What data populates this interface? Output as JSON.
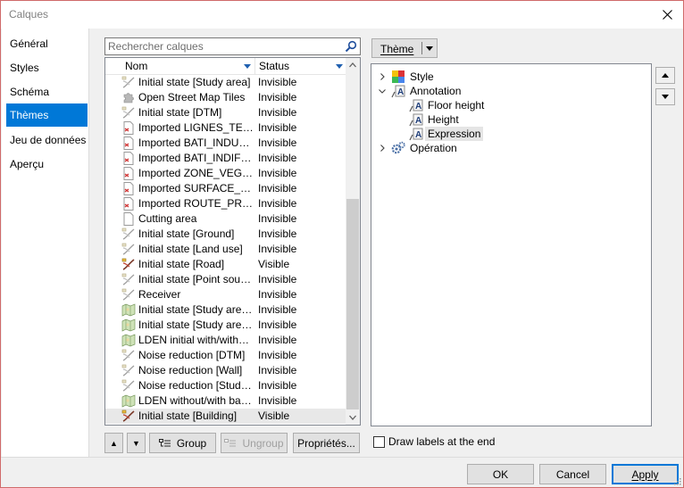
{
  "window": {
    "title": "Calques"
  },
  "nav": {
    "items": [
      {
        "label": "Général"
      },
      {
        "label": "Styles"
      },
      {
        "label": "Schéma"
      },
      {
        "label": "Thèmes"
      },
      {
        "label": "Jeu de données"
      },
      {
        "label": "Aperçu"
      }
    ],
    "active_index": 3
  },
  "search": {
    "placeholder": "Rechercher calques",
    "icon": "search-icon"
  },
  "layer_list": {
    "columns": {
      "name": "Nom",
      "status": "Status"
    },
    "rows": [
      {
        "name": "Initial state [Study area]",
        "status": "Invisible",
        "icon": "vector-style-icon"
      },
      {
        "name": "Open Street Map Tiles",
        "status": "Invisible",
        "icon": "puzzle-icon"
      },
      {
        "name": "Initial state [DTM]",
        "status": "Invisible",
        "icon": "vector-style-icon"
      },
      {
        "name": "Imported LIGNES_TERRITORY",
        "status": "Invisible",
        "icon": "document-layer-icon"
      },
      {
        "name": "Imported BATI_INDUSTRIEL",
        "status": "Invisible",
        "icon": "document-layer-icon"
      },
      {
        "name": "Imported BATI_INDIFFERENCIE",
        "status": "Invisible",
        "icon": "document-layer-icon"
      },
      {
        "name": "Imported ZONE_VEGETATION",
        "status": "Invisible",
        "icon": "document-layer-icon"
      },
      {
        "name": "Imported SURFACE_EAU",
        "status": "Invisible",
        "icon": "document-layer-icon"
      },
      {
        "name": "Imported ROUTE_PRIMAIRE",
        "status": "Invisible",
        "icon": "document-layer-icon"
      },
      {
        "name": "Cutting area",
        "status": "Invisible",
        "icon": "blank-document-icon"
      },
      {
        "name": "Initial state [Ground]",
        "status": "Invisible",
        "icon": "vector-style-icon"
      },
      {
        "name": "Initial state [Land use]",
        "status": "Invisible",
        "icon": "vector-style-icon"
      },
      {
        "name": "Initial state [Road]",
        "status": "Visible",
        "icon": "vector-style-colored-icon"
      },
      {
        "name": "Initial state [Point source]",
        "status": "Invisible",
        "icon": "vector-style-icon"
      },
      {
        "name": "Receiver",
        "status": "Invisible",
        "icon": "vector-style-icon"
      },
      {
        "name": "Initial state [Study area] [...]",
        "status": "Invisible",
        "icon": "map-raster-icon"
      },
      {
        "name": "Initial state [Study area] [...]",
        "status": "Invisible",
        "icon": "map-raster-icon"
      },
      {
        "name": "LDEN initial with/without...",
        "status": "Invisible",
        "icon": "map-raster-icon"
      },
      {
        "name": "Noise reduction [DTM]",
        "status": "Invisible",
        "icon": "vector-style-icon"
      },
      {
        "name": "Noise reduction [Wall]",
        "status": "Invisible",
        "icon": "vector-style-icon"
      },
      {
        "name": "Noise reduction [Study area]",
        "status": "Invisible",
        "icon": "vector-style-icon"
      },
      {
        "name": "LDEN without/with barrier",
        "status": "Invisible",
        "icon": "map-raster-icon"
      },
      {
        "name": "Initial state [Building]",
        "status": "Visible",
        "icon": "vector-style-colored-icon"
      }
    ],
    "selected_index": 22,
    "scroll_position": 0.7
  },
  "list_buttons": {
    "move_up": "▲",
    "move_down": "▼",
    "group": "Group",
    "ungroup": "Ungroup",
    "properties": "Propriétés..."
  },
  "theme": {
    "dropdown_label": "Thème",
    "tree": [
      {
        "label": "Style",
        "level": 0,
        "expander": "collapsed",
        "icon": "style-color-icon"
      },
      {
        "label": "Annotation",
        "level": 0,
        "expander": "expanded",
        "icon": "annotation-icon"
      },
      {
        "label": "Floor height",
        "level": 1,
        "icon": "annotation-icon"
      },
      {
        "label": "Height",
        "level": 1,
        "icon": "annotation-icon"
      },
      {
        "label": "Expression",
        "level": 1,
        "icon": "annotation-icon",
        "selected": true
      },
      {
        "label": "Opération",
        "level": 0,
        "expander": "collapsed",
        "icon": "gears-icon"
      }
    ]
  },
  "draw_labels": {
    "label": "Draw labels at the end",
    "checked": false
  },
  "footer": {
    "ok": "OK",
    "cancel": "Cancel",
    "apply": "Apply"
  },
  "colors": {
    "accent": "#0078d7",
    "border_window": "#d06a6a"
  }
}
